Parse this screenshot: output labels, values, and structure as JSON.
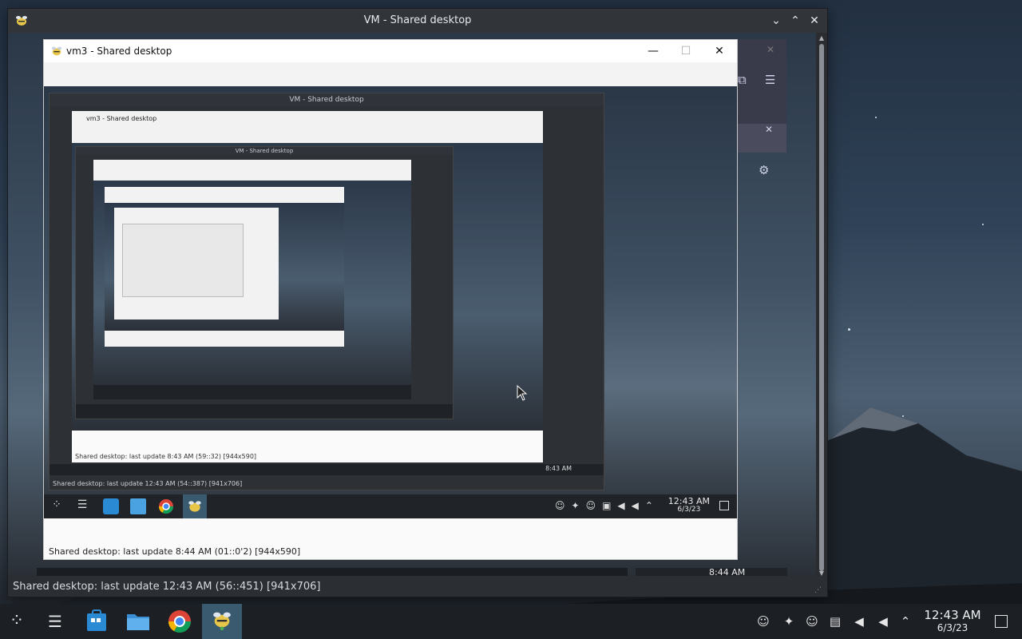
{
  "outer_window": {
    "title": "VM - Shared desktop",
    "minimize_glyph": "⌄",
    "maximize_glyph": "⌃",
    "close_glyph": "✕",
    "status": "Shared desktop: last update 12:43 AM (56::451) [941x706]"
  },
  "vm3_window": {
    "title": "vm3 - Shared desktop",
    "minimize_glyph": "—",
    "maximize_glyph": "☐",
    "close_glyph": "✕",
    "status": "Shared desktop: last update 8:44 AM (01::0'2) [944x590]"
  },
  "nested_level1": {
    "title": "VM - Shared desktop",
    "status": "Shared desktop: last update 12:43 AM (54::387) [941x706]",
    "time": "8:43 AM"
  },
  "nested_level2": {
    "title": "vm3 - Shared desktop",
    "status": "Shared desktop: last update 8:43 AM (59::32) [944x590]"
  },
  "nested_level3": {
    "title": "VM - Shared desktop"
  },
  "vm3_taskbar": {
    "time": "12:43 AM",
    "date": "6/3/23",
    "bottom_time": "8:44 AM"
  },
  "taskbar": {
    "time": "12:43 AM",
    "date": "6/3/23",
    "apps": [
      "launcher",
      "tasks",
      "store",
      "files",
      "chrome",
      "vm-app"
    ]
  },
  "icons": {
    "launcher": "launcher-icon",
    "tasks": "task-switcher-icon",
    "store": "store-icon",
    "files": "folder-icon",
    "chrome": "chrome-icon",
    "vm_app": "vm-app-icon"
  },
  "colors": {
    "taskbar": "#1c1f24",
    "active": "#3a5a70"
  }
}
